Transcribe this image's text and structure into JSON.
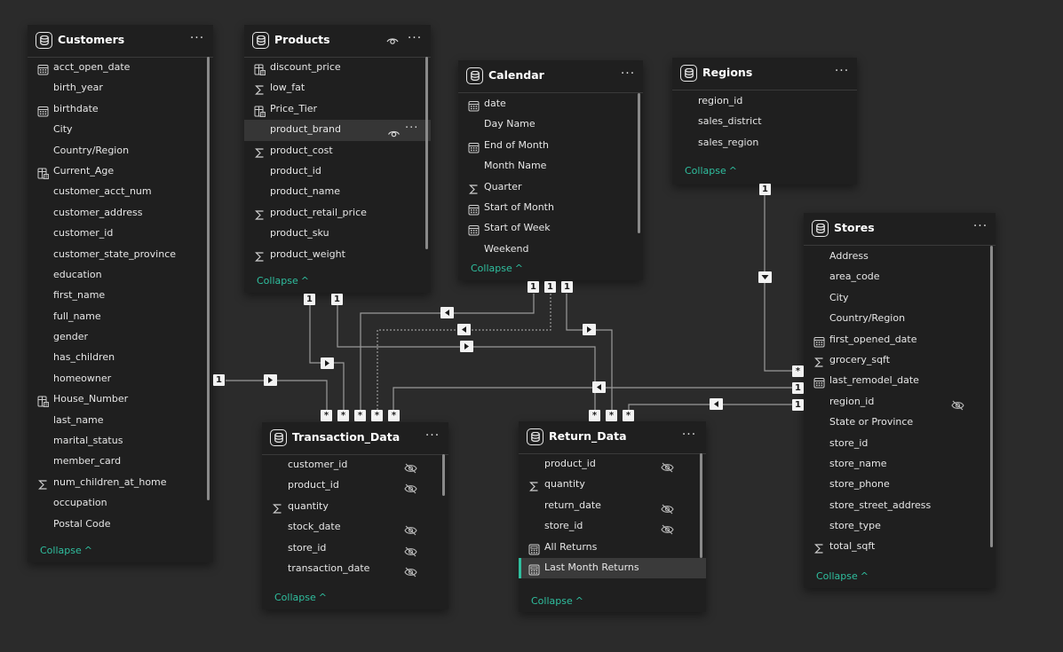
{
  "colors": {
    "background": "#2b2b2b",
    "card": "#1f1f1f",
    "accent": "#2fbf9f",
    "text": "#e6e6e6"
  },
  "tables": {
    "customers": {
      "title": "Customers",
      "collapse": "Collapse",
      "fields": [
        {
          "name": "acct_open_date",
          "icon": "calendar-icon"
        },
        {
          "name": "birth_year",
          "icon": ""
        },
        {
          "name": "birthdate",
          "icon": "calendar-icon"
        },
        {
          "name": "City",
          "icon": ""
        },
        {
          "name": "Country/Region",
          "icon": ""
        },
        {
          "name": "Current_Age",
          "icon": "calculated-column-icon"
        },
        {
          "name": "customer_acct_num",
          "icon": ""
        },
        {
          "name": "customer_address",
          "icon": ""
        },
        {
          "name": "customer_id",
          "icon": ""
        },
        {
          "name": "customer_state_province",
          "icon": ""
        },
        {
          "name": "education",
          "icon": ""
        },
        {
          "name": "first_name",
          "icon": ""
        },
        {
          "name": "full_name",
          "icon": ""
        },
        {
          "name": "gender",
          "icon": ""
        },
        {
          "name": "has_children",
          "icon": ""
        },
        {
          "name": "homeowner",
          "icon": ""
        },
        {
          "name": "House_Number",
          "icon": "calculated-column-icon"
        },
        {
          "name": "last_name",
          "icon": ""
        },
        {
          "name": "marital_status",
          "icon": ""
        },
        {
          "name": "member_card",
          "icon": ""
        },
        {
          "name": "num_children_at_home",
          "icon": "sigma-icon"
        },
        {
          "name": "occupation",
          "icon": ""
        },
        {
          "name": "Postal Code",
          "icon": ""
        }
      ]
    },
    "products": {
      "title": "Products",
      "collapse": "Collapse",
      "fields": [
        {
          "name": "discount_price",
          "icon": "calculated-column-icon"
        },
        {
          "name": "low_fat",
          "icon": "sigma-icon"
        },
        {
          "name": "Price_Tier",
          "icon": "calculated-column-icon"
        },
        {
          "name": "product_brand",
          "icon": ""
        },
        {
          "name": "product_cost",
          "icon": "sigma-icon"
        },
        {
          "name": "product_id",
          "icon": ""
        },
        {
          "name": "product_name",
          "icon": ""
        },
        {
          "name": "product_retail_price",
          "icon": "sigma-icon"
        },
        {
          "name": "product_sku",
          "icon": ""
        },
        {
          "name": "product_weight",
          "icon": "sigma-icon"
        }
      ]
    },
    "calendar": {
      "title": "Calendar",
      "collapse": "Collapse",
      "fields": [
        {
          "name": "date",
          "icon": "calendar-icon"
        },
        {
          "name": "Day Name",
          "icon": ""
        },
        {
          "name": "End of Month",
          "icon": "calendar-icon"
        },
        {
          "name": "Month Name",
          "icon": ""
        },
        {
          "name": "Quarter",
          "icon": "sigma-icon"
        },
        {
          "name": "Start of Month",
          "icon": "calendar-icon"
        },
        {
          "name": "Start of Week",
          "icon": "calendar-icon"
        },
        {
          "name": "Weekend",
          "icon": ""
        }
      ]
    },
    "regions": {
      "title": "Regions",
      "collapse": "Collapse",
      "fields": [
        {
          "name": "region_id",
          "icon": ""
        },
        {
          "name": "sales_district",
          "icon": ""
        },
        {
          "name": "sales_region",
          "icon": ""
        }
      ]
    },
    "stores": {
      "title": "Stores",
      "collapse": "Collapse",
      "fields": [
        {
          "name": "Address",
          "icon": ""
        },
        {
          "name": "area_code",
          "icon": ""
        },
        {
          "name": "City",
          "icon": ""
        },
        {
          "name": "Country/Region",
          "icon": ""
        },
        {
          "name": "first_opened_date",
          "icon": "calendar-icon"
        },
        {
          "name": "grocery_sqft",
          "icon": "sigma-icon"
        },
        {
          "name": "last_remodel_date",
          "icon": "calendar-icon"
        },
        {
          "name": "region_id",
          "icon": "",
          "hidden": true
        },
        {
          "name": "State or Province",
          "icon": ""
        },
        {
          "name": "store_id",
          "icon": ""
        },
        {
          "name": "store_name",
          "icon": ""
        },
        {
          "name": "store_phone",
          "icon": ""
        },
        {
          "name": "store_street_address",
          "icon": ""
        },
        {
          "name": "store_type",
          "icon": ""
        },
        {
          "name": "total_sqft",
          "icon": "sigma-icon"
        }
      ]
    },
    "transaction_data": {
      "title": "Transaction_Data",
      "collapse": "Collapse",
      "fields": [
        {
          "name": "customer_id",
          "icon": "",
          "hidden": true
        },
        {
          "name": "product_id",
          "icon": "",
          "hidden": true
        },
        {
          "name": "quantity",
          "icon": "sigma-icon"
        },
        {
          "name": "stock_date",
          "icon": "",
          "hidden": true
        },
        {
          "name": "store_id",
          "icon": "",
          "hidden": true
        },
        {
          "name": "transaction_date",
          "icon": "",
          "hidden": true
        }
      ]
    },
    "return_data": {
      "title": "Return_Data",
      "collapse": "Collapse",
      "fields": [
        {
          "name": "product_id",
          "icon": "",
          "hidden": true
        },
        {
          "name": "quantity",
          "icon": "sigma-icon"
        },
        {
          "name": "return_date",
          "icon": "",
          "hidden": true
        },
        {
          "name": "store_id",
          "icon": "",
          "hidden": true
        },
        {
          "name": "All Returns",
          "icon": "measure-icon"
        },
        {
          "name": "Last Month Returns",
          "icon": "measure-icon",
          "selected": true
        }
      ]
    }
  },
  "cardinality": {
    "one": "1",
    "many": "*"
  }
}
